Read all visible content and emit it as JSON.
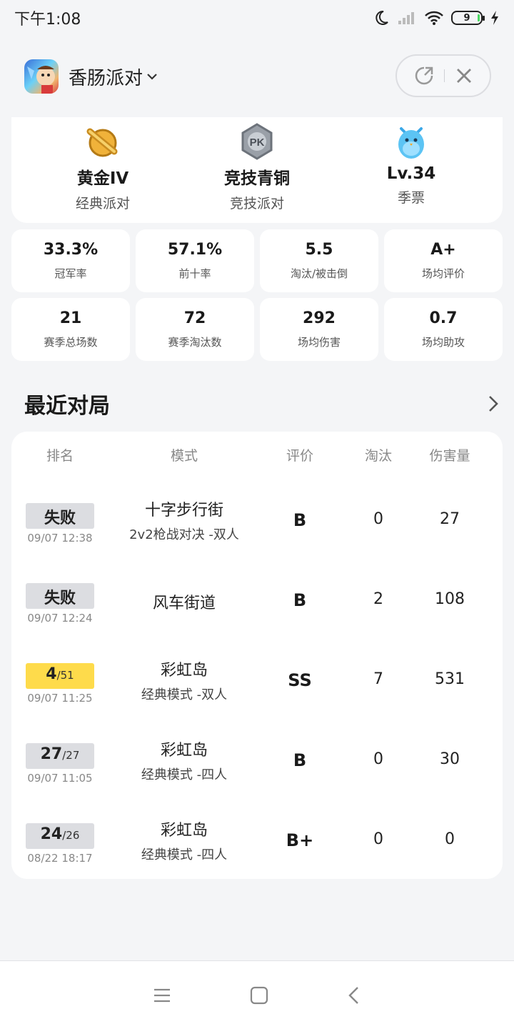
{
  "status": {
    "time": "下午1:08",
    "battery": "9",
    "icons": [
      "moon-icon",
      "signal-icon",
      "wifi-icon",
      "battery-icon",
      "charging-icon"
    ]
  },
  "header": {
    "app_title": "香肠派对",
    "icons": [
      "app-logo",
      "chevron-down-icon",
      "share-icon",
      "close-icon"
    ]
  },
  "ranks": [
    {
      "title": "黄金IV",
      "sub": "经典派对",
      "icon": "gold-rank-icon"
    },
    {
      "title": "竞技青铜",
      "sub": "竞技派对",
      "icon": "pk-bronze-icon"
    },
    {
      "title": "Lv.34",
      "sub": "季票",
      "icon": "season-pass-bird-icon"
    }
  ],
  "stats": [
    {
      "value": "33.3%",
      "label": "冠军率"
    },
    {
      "value": "57.1%",
      "label": "前十率"
    },
    {
      "value": "5.5",
      "label": "淘汰/被击倒"
    },
    {
      "value": "A+",
      "label": "场均评价"
    },
    {
      "value": "21",
      "label": "赛季总场数"
    },
    {
      "value": "72",
      "label": "赛季淘汰数"
    },
    {
      "value": "292",
      "label": "场均伤害"
    },
    {
      "value": "0.7",
      "label": "场均助攻"
    }
  ],
  "recent": {
    "title": "最近对局",
    "columns": {
      "rank": "排名",
      "mode": "模式",
      "rating": "评价",
      "elim": "淘汰",
      "damage": "伤害量"
    },
    "games": [
      {
        "rank": "失败",
        "total": "",
        "time": "09/07 12:38",
        "mode": "十字步行街",
        "sub": "2v2枪战对决 -双人",
        "rating": "B",
        "elim": "0",
        "damage": "27",
        "badge": "gray"
      },
      {
        "rank": "失败",
        "total": "",
        "time": "09/07 12:24",
        "mode": "风车街道",
        "sub": "",
        "rating": "B",
        "elim": "2",
        "damage": "108",
        "badge": "gray"
      },
      {
        "rank": "4",
        "total": "/51",
        "time": "09/07 11:25",
        "mode": "彩虹岛",
        "sub": "经典模式 -双人",
        "rating": "SS",
        "elim": "7",
        "damage": "531",
        "badge": "gold"
      },
      {
        "rank": "27",
        "total": "/27",
        "time": "09/07 11:05",
        "mode": "彩虹岛",
        "sub": "经典模式 -四人",
        "rating": "B",
        "elim": "0",
        "damage": "30",
        "badge": "gray"
      },
      {
        "rank": "24",
        "total": "/26",
        "time": "08/22 18:17",
        "mode": "彩虹岛",
        "sub": "经典模式 -四人",
        "rating": "B+",
        "elim": "0",
        "damage": "0",
        "badge": "gray"
      }
    ]
  },
  "nav": [
    "menu-icon",
    "home-icon",
    "back-icon"
  ]
}
